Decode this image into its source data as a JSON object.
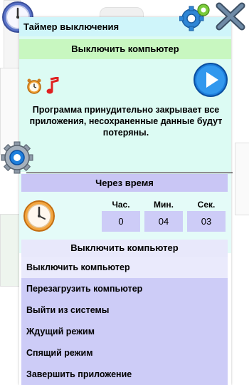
{
  "window": {
    "title": "Таймер выключения"
  },
  "action": {
    "title": "Выключить компьютер",
    "description": "Программа принудительно закрывает все приложения, несохраненные данные будут потеряны."
  },
  "timer": {
    "mode_label": "Через время",
    "hours_label": "Час.",
    "minutes_label": "Мин.",
    "seconds_label": "Сек.",
    "hours": "0",
    "minutes": "04",
    "seconds": "03"
  },
  "dropdown": {
    "header": "Выключить компьютер",
    "items": [
      {
        "label": "Выключить компьютер"
      },
      {
        "label": "Перезагрузить компьютер"
      },
      {
        "label": "Выйти из системы"
      },
      {
        "label": "Ждущий режим"
      },
      {
        "label": "Спящий режим"
      },
      {
        "label": "Завершить приложение"
      }
    ],
    "selected_index": 0
  },
  "icons": {
    "top_left": "clock-icon",
    "settings": "gear-icon",
    "close": "close-icon",
    "alarm": "alarm-clock-icon",
    "music": "music-note-icon",
    "play": "play-icon",
    "side": "settings-gear-icon",
    "timer_clock": "timer-clock-icon"
  },
  "colors": {
    "titlebar": "#cff5fa",
    "action_header": "#c8f7c0",
    "section_header": "#c9c6f5",
    "menu_bg": "#cdccf7",
    "selected_item": "#eaeafc",
    "play_blue": "#1e7fdc"
  }
}
